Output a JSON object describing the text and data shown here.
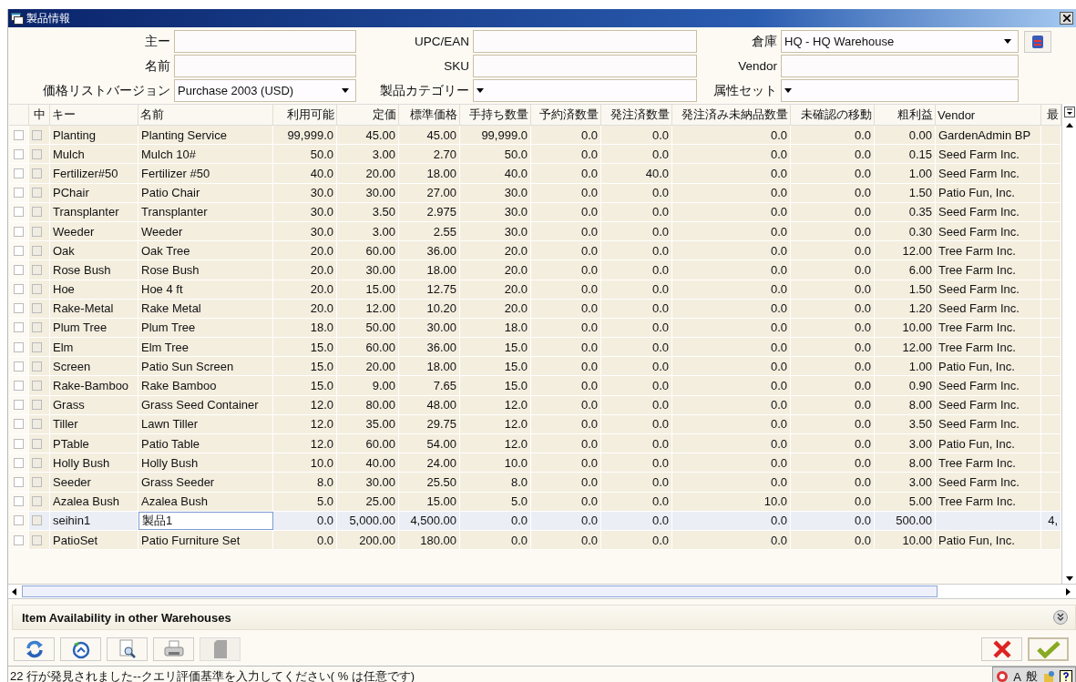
{
  "window": {
    "title": "製品情報"
  },
  "form": [
    {
      "label": "主ー",
      "kind": "text"
    },
    {
      "label": "UPC/EAN",
      "kind": "text"
    },
    {
      "label": "倉庫",
      "kind": "select",
      "value": "HQ - HQ Warehouse"
    },
    {
      "label": "名前",
      "kind": "text"
    },
    {
      "label": "SKU",
      "kind": "text"
    },
    {
      "label": "Vendor",
      "kind": "text"
    },
    {
      "label": "価格リストバージョン",
      "kind": "select",
      "value": "Purchase 2003 (USD)"
    },
    {
      "label": "製品カテゴリー",
      "kind": "select"
    },
    {
      "label": "属性セット",
      "kind": "select"
    }
  ],
  "table": {
    "columns": [
      {
        "kind": "check"
      },
      {
        "label": "中",
        "kind": "check"
      },
      {
        "label": "キー",
        "kind": "text"
      },
      {
        "label": "名前",
        "kind": "text"
      },
      {
        "label": "利用可能",
        "kind": "number"
      },
      {
        "label": "定価",
        "kind": "number"
      },
      {
        "label": "標準価格",
        "kind": "number"
      },
      {
        "label": "手持ち数量",
        "kind": "number"
      },
      {
        "label": "予約済数量",
        "kind": "number"
      },
      {
        "label": "発注済数量",
        "kind": "number"
      },
      {
        "label": "発注済み未納品数量",
        "kind": "number"
      },
      {
        "label": "未確認の移動",
        "kind": "number"
      },
      {
        "label": "粗利益",
        "kind": "number"
      },
      {
        "label": "Vendor",
        "kind": "text"
      },
      {
        "label": "最",
        "kind": "number"
      }
    ],
    "rows": [
      {
        "selected": false,
        "cells": [
          {
            "checked": false
          },
          {
            "checked": false
          },
          "Planting",
          "Planting Service",
          "99,999.0",
          "45.00",
          "45.00",
          "99,999.0",
          "0.0",
          "0.0",
          "0.0",
          "0.0",
          "0.00",
          "GardenAdmin BP",
          null
        ]
      },
      {
        "selected": false,
        "cells": [
          {
            "checked": false
          },
          {
            "checked": false
          },
          "Mulch",
          "Mulch 10#",
          "50.0",
          "3.00",
          "2.70",
          "50.0",
          "0.0",
          "0.0",
          "0.0",
          "0.0",
          "0.15",
          "Seed Farm Inc.",
          null
        ]
      },
      {
        "selected": false,
        "cells": [
          {
            "checked": false
          },
          {
            "checked": false
          },
          "Fertilizer#50",
          "Fertilizer #50",
          "40.0",
          "20.00",
          "18.00",
          "40.0",
          "0.0",
          "40.0",
          "0.0",
          "0.0",
          "1.00",
          "Seed Farm Inc.",
          null
        ]
      },
      {
        "selected": false,
        "cells": [
          {
            "checked": false
          },
          {
            "checked": false
          },
          "PChair",
          "Patio Chair",
          "30.0",
          "30.00",
          "27.00",
          "30.0",
          "0.0",
          "0.0",
          "0.0",
          "0.0",
          "1.50",
          "Patio Fun, Inc.",
          null
        ]
      },
      {
        "selected": false,
        "cells": [
          {
            "checked": false
          },
          {
            "checked": false
          },
          "Transplanter",
          "Transplanter",
          "30.0",
          "3.50",
          "2.975",
          "30.0",
          "0.0",
          "0.0",
          "0.0",
          "0.0",
          "0.35",
          "Seed Farm Inc.",
          null
        ]
      },
      {
        "selected": false,
        "cells": [
          {
            "checked": false
          },
          {
            "checked": false
          },
          "Weeder",
          "Weeder",
          "30.0",
          "3.00",
          "2.55",
          "30.0",
          "0.0",
          "0.0",
          "0.0",
          "0.0",
          "0.30",
          "Seed Farm Inc.",
          null
        ]
      },
      {
        "selected": false,
        "cells": [
          {
            "checked": false
          },
          {
            "checked": false
          },
          "Oak",
          "Oak Tree",
          "20.0",
          "60.00",
          "36.00",
          "20.0",
          "0.0",
          "0.0",
          "0.0",
          "0.0",
          "12.00",
          "Tree Farm Inc.",
          null
        ]
      },
      {
        "selected": false,
        "cells": [
          {
            "checked": false
          },
          {
            "checked": false
          },
          "Rose Bush",
          "Rose Bush",
          "20.0",
          "30.00",
          "18.00",
          "20.0",
          "0.0",
          "0.0",
          "0.0",
          "0.0",
          "6.00",
          "Tree Farm Inc.",
          null
        ]
      },
      {
        "selected": false,
        "cells": [
          {
            "checked": false
          },
          {
            "checked": false
          },
          "Hoe",
          "Hoe 4 ft",
          "20.0",
          "15.00",
          "12.75",
          "20.0",
          "0.0",
          "0.0",
          "0.0",
          "0.0",
          "1.50",
          "Seed Farm Inc.",
          null
        ]
      },
      {
        "selected": false,
        "cells": [
          {
            "checked": false
          },
          {
            "checked": false
          },
          "Rake-Metal",
          "Rake Metal",
          "20.0",
          "12.00",
          "10.20",
          "20.0",
          "0.0",
          "0.0",
          "0.0",
          "0.0",
          "1.20",
          "Seed Farm Inc.",
          null
        ]
      },
      {
        "selected": false,
        "cells": [
          {
            "checked": false
          },
          {
            "checked": false
          },
          "Plum Tree",
          "Plum Tree",
          "18.0",
          "50.00",
          "30.00",
          "18.0",
          "0.0",
          "0.0",
          "0.0",
          "0.0",
          "10.00",
          "Tree Farm Inc.",
          null
        ]
      },
      {
        "selected": false,
        "cells": [
          {
            "checked": false
          },
          {
            "checked": false
          },
          "Elm",
          "Elm Tree",
          "15.0",
          "60.00",
          "36.00",
          "15.0",
          "0.0",
          "0.0",
          "0.0",
          "0.0",
          "12.00",
          "Tree Farm Inc.",
          null
        ]
      },
      {
        "selected": false,
        "cells": [
          {
            "checked": false
          },
          {
            "checked": false
          },
          "Screen",
          "Patio Sun Screen",
          "15.0",
          "20.00",
          "18.00",
          "15.0",
          "0.0",
          "0.0",
          "0.0",
          "0.0",
          "1.00",
          "Patio Fun, Inc.",
          null
        ]
      },
      {
        "selected": false,
        "cells": [
          {
            "checked": false
          },
          {
            "checked": false
          },
          "Rake-Bamboo",
          "Rake Bamboo",
          "15.0",
          "9.00",
          "7.65",
          "15.0",
          "0.0",
          "0.0",
          "0.0",
          "0.0",
          "0.90",
          "Seed Farm Inc.",
          null
        ]
      },
      {
        "selected": false,
        "cells": [
          {
            "checked": false
          },
          {
            "checked": false
          },
          "Grass",
          "Grass Seed Container",
          "12.0",
          "80.00",
          "48.00",
          "12.0",
          "0.0",
          "0.0",
          "0.0",
          "0.0",
          "8.00",
          "Seed Farm Inc.",
          null
        ]
      },
      {
        "selected": false,
        "cells": [
          {
            "checked": false
          },
          {
            "checked": false
          },
          "Tiller",
          "Lawn Tiller",
          "12.0",
          "35.00",
          "29.75",
          "12.0",
          "0.0",
          "0.0",
          "0.0",
          "0.0",
          "3.50",
          "Seed Farm Inc.",
          null
        ]
      },
      {
        "selected": false,
        "cells": [
          {
            "checked": false
          },
          {
            "checked": false
          },
          "PTable",
          "Patio Table",
          "12.0",
          "60.00",
          "54.00",
          "12.0",
          "0.0",
          "0.0",
          "0.0",
          "0.0",
          "3.00",
          "Patio Fun, Inc.",
          null
        ]
      },
      {
        "selected": false,
        "cells": [
          {
            "checked": false
          },
          {
            "checked": false
          },
          "Holly Bush",
          "Holly Bush",
          "10.0",
          "40.00",
          "24.00",
          "10.0",
          "0.0",
          "0.0",
          "0.0",
          "0.0",
          "8.00",
          "Tree Farm Inc.",
          null
        ]
      },
      {
        "selected": false,
        "cells": [
          {
            "checked": false
          },
          {
            "checked": false
          },
          "Seeder",
          "Grass Seeder",
          "8.0",
          "30.00",
          "25.50",
          "8.0",
          "0.0",
          "0.0",
          "0.0",
          "0.0",
          "3.00",
          "Seed Farm Inc.",
          null
        ]
      },
      {
        "selected": false,
        "cells": [
          {
            "checked": false
          },
          {
            "checked": false
          },
          "Azalea Bush",
          "Azalea Bush",
          "5.0",
          "25.00",
          "15.00",
          "5.0",
          "0.0",
          "0.0",
          "10.0",
          "0.0",
          "5.00",
          "Tree Farm Inc.",
          null
        ]
      },
      {
        "selected": true,
        "cells": [
          {
            "checked": false
          },
          {
            "checked": false
          },
          "seihin1",
          "製品1",
          "0.0",
          "5,000.00",
          "4,500.00",
          "0.0",
          "0.0",
          "0.0",
          "0.0",
          "0.0",
          "500.00",
          null,
          "4,"
        ]
      },
      {
        "selected": false,
        "cells": [
          {
            "checked": false
          },
          {
            "checked": false
          },
          "PatioSet",
          "Patio Furniture Set",
          "0.0",
          "200.00",
          "180.00",
          "0.0",
          "0.0",
          "0.0",
          "0.0",
          "0.0",
          "10.00",
          "Patio Fun, Inc.",
          null
        ]
      }
    ]
  },
  "panel": {
    "title": "Item Availability in other Warehouses",
    "expanded": false
  },
  "toolbar": [
    {
      "kind": "refresh",
      "disabled": false
    },
    {
      "kind": "reset",
      "disabled": false
    },
    {
      "kind": "zoom",
      "disabled": false
    },
    {
      "kind": "print",
      "disabled": false
    },
    {
      "kind": "archive",
      "disabled": true
    }
  ],
  "status_bar": {
    "text": "22 行が発見されました--クエリ評価基準を入力してください( % は任意です)",
    "ime": [
      "A",
      "般"
    ]
  }
}
